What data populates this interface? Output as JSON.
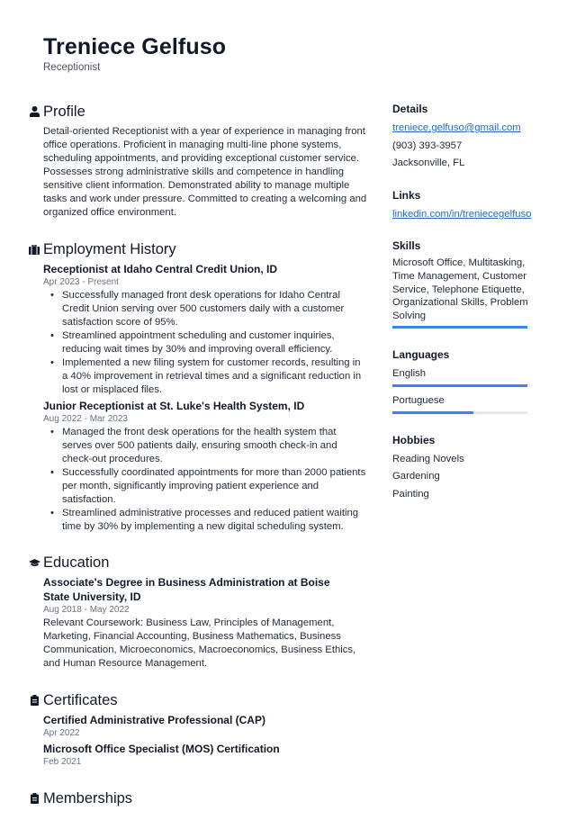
{
  "header": {
    "name": "Treniece Gelfuso",
    "role": "Receptionist"
  },
  "colors": {
    "accent": "#3b82f6",
    "link": "#2563eb",
    "text": "#1f2937",
    "muted": "#6b7280"
  },
  "profile": {
    "title": "Profile",
    "icon": "user-icon",
    "text": "Detail-oriented Receptionist with a year of experience in managing front office operations. Proficient in managing multi-line phone systems, scheduling appointments, and providing exceptional customer service. Possesses strong administrative skills and competence in handling sensitive client information. Demonstrated ability to manage multiple tasks and work under pressure. Committed to creating a welcoming and organized office environment."
  },
  "employment": {
    "title": "Employment History",
    "icon": "briefcase-icon",
    "jobs": [
      {
        "title": "Receptionist at Idaho Central Credit Union, ID",
        "dates": "Apr 2023 - Present",
        "bullets": [
          "Successfully managed front desk operations for Idaho Central Credit Union serving over 500 customers daily with a customer satisfaction score of 95%.",
          "Streamlined appointment scheduling and customer inquiries, reducing wait times by 30% and improving overall efficiency.",
          "Implemented a new filing system for customer records, resulting in a 40% improvement in retrieval times and a significant reduction in lost or misplaced files."
        ]
      },
      {
        "title": "Junior Receptionist at St. Luke's Health System, ID",
        "dates": "Aug 2022 - Mar 2023",
        "bullets": [
          "Managed the front desk operations for the health system that serves over 500 patients daily, ensuring smooth check-in and check-out procedures.",
          "Successfully coordinated appointments for more than 2000 patients per month, significantly improving patient experience and satisfaction.",
          "Streamlined administrative processes and reduced patient waiting time by 30% by implementing a new digital scheduling system."
        ]
      }
    ]
  },
  "education": {
    "title": "Education",
    "icon": "graduation-cap-icon",
    "entries": [
      {
        "title": "Associate's Degree in Business Administration at Boise State University, ID",
        "dates": "Aug 2018 - May 2022",
        "text": "Relevant Coursework: Business Law, Principles of Management, Marketing, Financial Accounting, Business Mathematics, Business Communication, Microeconomics, Macroeconomics, Business Ethics, and Human Resource Management."
      }
    ]
  },
  "certificates": {
    "title": "Certificates",
    "icon": "clipboard-icon",
    "items": [
      {
        "title": "Certified Administrative Professional (CAP)",
        "date": "Apr 2022"
      },
      {
        "title": "Microsoft Office Specialist (MOS) Certification",
        "date": "Feb 2021"
      }
    ]
  },
  "memberships": {
    "title": "Memberships",
    "icon": "clipboard-icon"
  },
  "sidebar": {
    "details": {
      "title": "Details",
      "email": "treniece.gelfuso@gmail.com",
      "phone": "(903) 393-3957",
      "location": "Jacksonville, FL"
    },
    "links": {
      "title": "Links",
      "items": [
        "linkedin.com/in/treniecegelfuso"
      ]
    },
    "skills": {
      "title": "Skills",
      "text": "Microsoft Office, Multitasking, Time Management, Customer Service, Telephone Etiquette, Organizational Skills, Problem Solving",
      "level": 1.0
    },
    "languages": {
      "title": "Languages",
      "items": [
        {
          "name": "English",
          "level": 1.0
        },
        {
          "name": "Portuguese",
          "level": 0.6
        }
      ]
    },
    "hobbies": {
      "title": "Hobbies",
      "items": [
        "Reading Novels",
        "Gardening",
        "Painting"
      ]
    }
  }
}
